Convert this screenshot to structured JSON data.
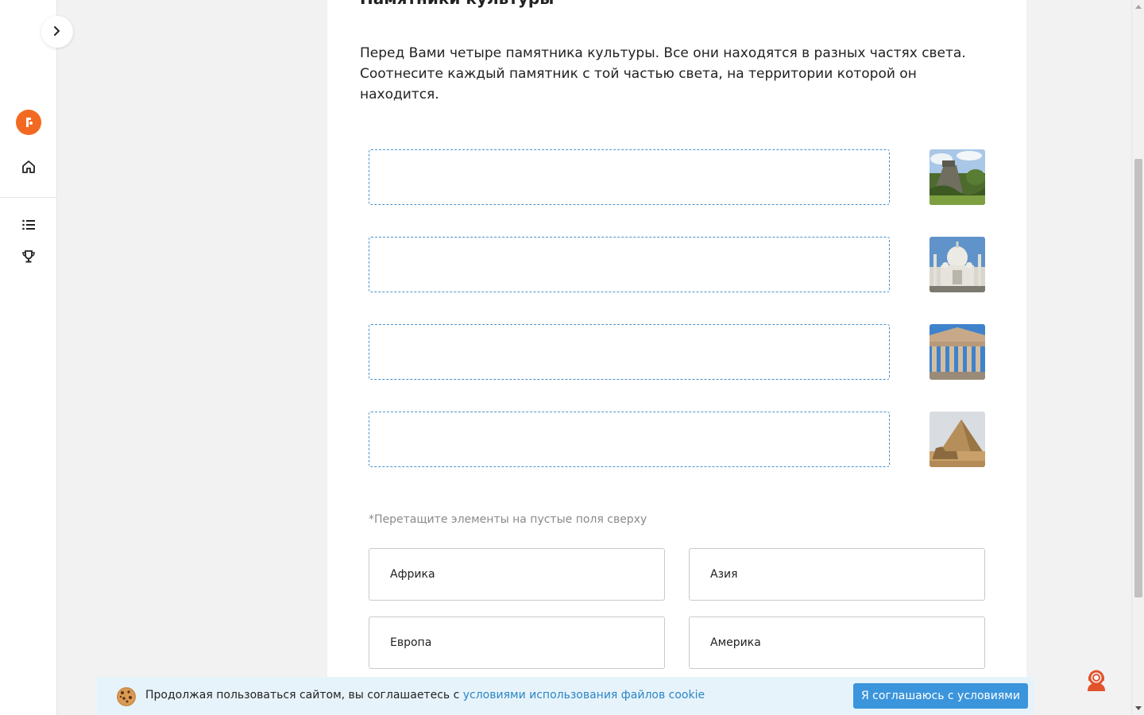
{
  "lesson": {
    "title": "Памятники культуры",
    "instructions": "Перед Вами четыре памятника культуры. Все они находятся в разных частях света. Соотнесите каждый памятник с той частью света, на территории которой он находится.",
    "drop_rows": [
      {
        "image": "mayan-pyramid-jungle"
      },
      {
        "image": "taj-mahal"
      },
      {
        "image": "parthenon"
      },
      {
        "image": "pyramid-and-sphinx"
      }
    ],
    "hint": "*Перетащите элементы на пустые поля сверху",
    "options": [
      {
        "label": "Африка"
      },
      {
        "label": "Азия"
      },
      {
        "label": "Европа"
      },
      {
        "label": "Америка"
      }
    ]
  },
  "sidebar": {
    "icons": [
      "chevron-right-icon",
      "logo-icon",
      "home-icon",
      "list-icon",
      "trophy-icon"
    ]
  },
  "cookie": {
    "text": "Продолжая пользоваться сайтом, вы соглашаетесь с ",
    "link": "условиями использования файлов cookie",
    "accept": "Я соглашаюсь с условиями"
  },
  "colors": {
    "accent": "#f26a21",
    "drop_border": "#4a90c8",
    "cookie_bg": "#e7f3fb",
    "cookie_button": "#3b95dc",
    "link": "#2b86c5"
  }
}
